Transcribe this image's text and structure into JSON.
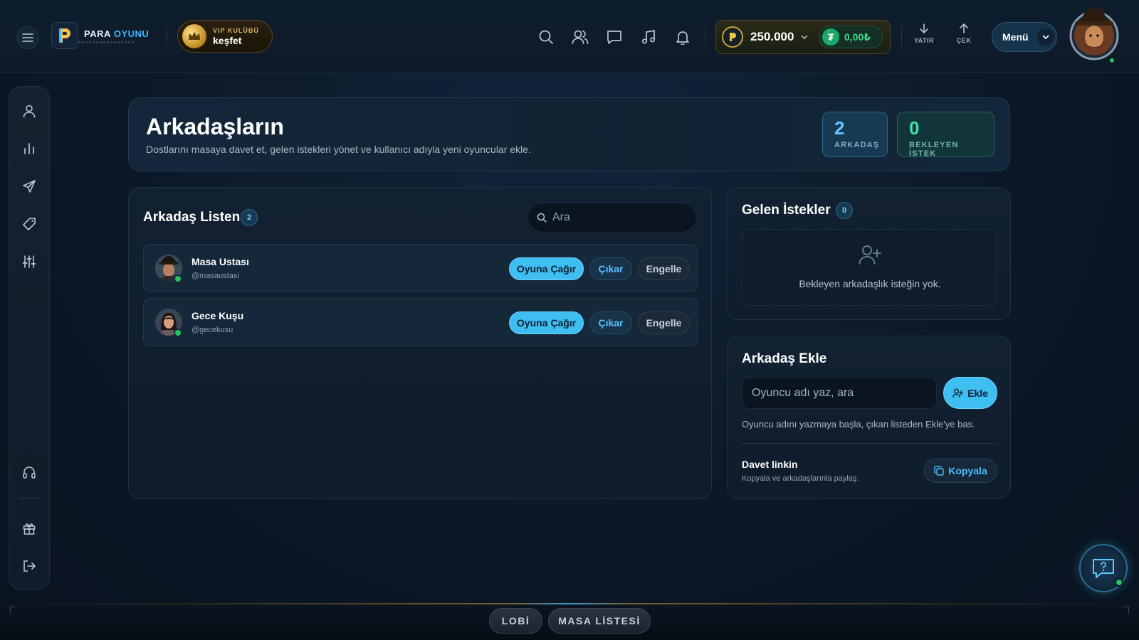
{
  "header": {
    "logo": {
      "part1": "PARA",
      "part2": "OYUNU"
    },
    "vip": {
      "title": "VIP KULÜBÜ",
      "cta": "keşfet"
    },
    "balance": {
      "amount": "250.000",
      "tl_amount": "0,00₺",
      "tl_symbol": "₮"
    },
    "deposit_label": "YATIR",
    "withdraw_label": "ÇEK",
    "menu_label": "Menü",
    "icons": [
      "search-icon",
      "friends-icon",
      "chat-icon",
      "music-icon",
      "bell-icon"
    ]
  },
  "sidebar": {
    "items": [
      "profile-icon",
      "stats-icon",
      "send-icon",
      "tag-icon",
      "sliders-icon",
      "headset-icon",
      "gift-icon",
      "logout-icon"
    ]
  },
  "hero": {
    "title": "Arkadaşların",
    "subtitle": "Dostlarını masaya davet et, gelen istekleri yönet ve kullanıcı adıyla yeni oyuncular ekle.",
    "stats": [
      {
        "value": "2",
        "label": "ARKADAŞ"
      },
      {
        "value": "0",
        "label": "BEKLEYEN İSTEK"
      }
    ]
  },
  "friends": {
    "title": "Arkadaş Listen",
    "count": "2",
    "search_placeholder": "Ara",
    "list": [
      {
        "name": "Masa Ustası",
        "handle": "@masaustasi",
        "invite": "Oyuna Çağır",
        "remove": "Çıkar",
        "block": "Engelle"
      },
      {
        "name": "Gece Kuşu",
        "handle": "@gecekusu",
        "invite": "Oyuna Çağır",
        "remove": "Çıkar",
        "block": "Engelle"
      }
    ]
  },
  "requests": {
    "title": "Gelen İstekler",
    "count": "0",
    "empty_text": "Bekleyen arkadaşlık isteğin yok."
  },
  "add_friend": {
    "title": "Arkadaş Ekle",
    "placeholder": "Oyuncu adı yaz, ara",
    "button": "Ekle",
    "hint": "Oyuncu adını yazmaya başla, çıkan listeden Ekle'ye bas.",
    "invite_title": "Davet linkin",
    "invite_sub": "Kopyala ve arkadaşlarınla paylaş.",
    "copy_button": "Kopyala"
  },
  "bottom": {
    "lobby": "LOBİ",
    "tables": "MASA LİSTESİ"
  },
  "colors": {
    "accent": "#3fbef2",
    "gold": "#c9a13a",
    "online": "#22c55e",
    "pending": "#3fe0b0"
  }
}
